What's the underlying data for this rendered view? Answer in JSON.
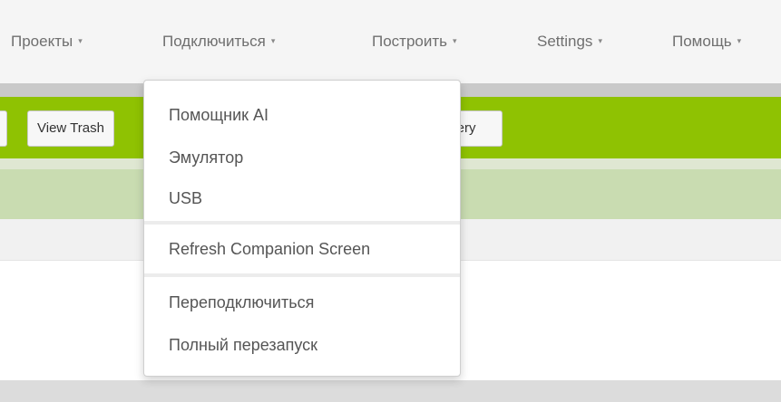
{
  "top_menu": [
    {
      "label": "Проекты"
    },
    {
      "label": "Подключиться"
    },
    {
      "label": "Построить"
    },
    {
      "label": "Settings"
    },
    {
      "label": "Помощь"
    }
  ],
  "caret_glyph": "▾",
  "toolbar": {
    "view_trash_label": "View Trash",
    "gallery_partial_label": "llery"
  },
  "connect_menu": {
    "items": [
      {
        "label": "Помощник AI"
      },
      {
        "label": "Эмулятор"
      },
      {
        "label": "USB"
      },
      {
        "label": "Refresh Companion Screen"
      },
      {
        "label": "Переподключиться"
      },
      {
        "label": "Полный перезапуск"
      }
    ]
  },
  "colors": {
    "toolbar_green": "#8fc202",
    "light_green": "#c9dcb1",
    "menu_text": "#6f6f6f"
  }
}
